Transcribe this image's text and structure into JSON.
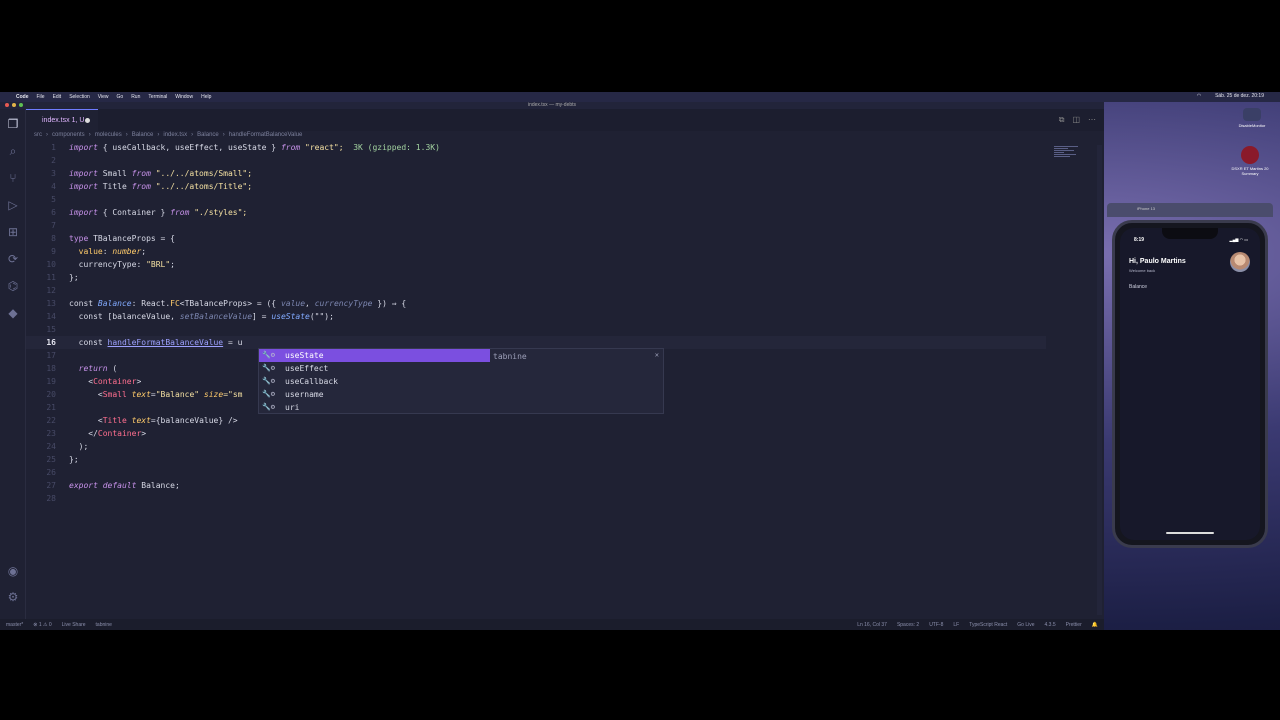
{
  "menubar": {
    "items": [
      "Code",
      "File",
      "Edit",
      "Selection",
      "View",
      "Go",
      "Run",
      "Terminal",
      "Window",
      "Help"
    ],
    "clock": "Sáb. 25 de dez. 20:19"
  },
  "window": {
    "title": "index.tsx — my-debts"
  },
  "tab": {
    "label": "index.tsx 1, U"
  },
  "breadcrumb": [
    "src",
    "components",
    "molecules",
    "Balance",
    "index.tsx",
    "Balance",
    "handleFormatBalanceValue"
  ],
  "code": {
    "l1a": "import",
    "l1b": " { useCallback, useEffect, useState } ",
    "l1c": "from",
    "l1d": " \"react\";",
    "l1e": "  3K (gzipped: 1.3K)",
    "l3a": "import",
    "l3b": " Small ",
    "l3c": "from",
    "l3d": " \"../../atoms/Small\";",
    "l4a": "import",
    "l4b": " Title ",
    "l4c": "from",
    "l4d": " \"../../atoms/Title\";",
    "l6a": "import",
    "l6b": " { Container } ",
    "l6c": "from",
    "l6d": " \"./styles\";",
    "l8a": "type",
    "l8b": " TBalanceProps = {",
    "l9a": "  value",
    "l9b": ": ",
    "l9c": "number",
    "l9d": ";",
    "l10a": "  currencyType",
    "l10b": ": ",
    "l10c": "\"BRL\"",
    "l10d": ";",
    "l11": "};",
    "l13a": "const ",
    "l13b": "Balance",
    "l13c": ": React.",
    "l13d": "FC",
    "l13e": "<TBalanceProps> = ({ ",
    "l13f": "value",
    "l13g": ", ",
    "l13h": "currencyType",
    "l13i": " }) ⇒ {",
    "l14a": "  const [",
    "l14b": "balanceValue",
    "l14c": ", ",
    "l14d": "setBalanceValue",
    "l14e": "] = ",
    "l14f": "useState",
    "l14g": "(\"\");",
    "l16a": "  const ",
    "l16b": "handleFormatBalanceValue",
    "l16c": " = u",
    "l18a": "  return",
    "l18b": " (",
    "l19a": "    <",
    "l19b": "Container",
    "l19c": ">",
    "l20a": "      <",
    "l20b": "Small",
    "l20c": " text",
    "l20d": "=",
    "l20e": "\"Balance\"",
    "l20f": " size",
    "l20g": "=\"sm",
    "l22a": "      <",
    "l22b": "Title",
    "l22c": " text",
    "l22d": "={",
    "l22e": "balanceValue",
    "l22f": "} />",
    "l23a": "    </",
    "l23b": "Container",
    "l23c": ">",
    "l24": "  );",
    "l25": "};",
    "l27a": "export",
    "l27b": " default",
    "l27c": " Balance;"
  },
  "suggest": {
    "items": [
      "useState",
      "useEffect",
      "useCallback",
      "username",
      "uri"
    ],
    "detail": "tabnine"
  },
  "status": {
    "branch": "master*",
    "problems": "⊗ 1 ⚠ 0",
    "liveshare": "Live Share",
    "tabnine": "tabnine",
    "position": "Ln 16, Col 37",
    "spaces": "Spaces: 2",
    "encoding": "UTF-8",
    "eol": "LF",
    "language": "TypeScript React",
    "golive": "Go Live",
    "version": "4.3.5",
    "prettier": "Prettier"
  },
  "desktop": {
    "icon1": "DisableMonitor",
    "icon2": "DSXR ET Martins 20 Summary"
  },
  "simulator": {
    "device": "iPhone 13",
    "time": "8:19",
    "greeting": "Hi, Paulo Martins",
    "welcome": "Welcome back",
    "balance_label": "Balance"
  }
}
